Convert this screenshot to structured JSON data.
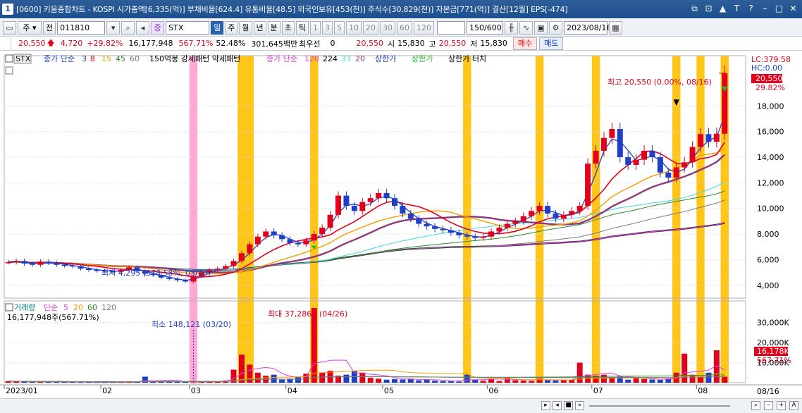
{
  "window": {
    "number": "1",
    "title": "[0600] 키움종합차트 - KOSPI 시가총액[6,335(억)] 부채비율[624.4] 유통비율[48.5] 외국인보유[453(천)] 주식수[30,829(천)] 자본금[771(억)] 결산[12월] EPS[-474]",
    "buttons": [
      "⧉",
      "⊡",
      "▲",
      "T",
      "?",
      "–",
      "□",
      "✕"
    ]
  },
  "toolbar": {
    "period_select": "주",
    "prev_label": "전",
    "code": "011810",
    "stock_name": "STX",
    "period_tabs": [
      "일",
      "주",
      "월",
      "년",
      "분",
      "초",
      "틱"
    ],
    "intervals": [
      "1",
      "3",
      "5",
      "10",
      "20",
      "30",
      "60",
      "120"
    ],
    "count": "150/600",
    "date": "2023/08/16"
  },
  "quote": {
    "price": "20,550",
    "change": "4,720",
    "change_pct": "+29.82%",
    "volume": "16,177,948",
    "vol_ratio": "567.71%",
    "turnover": "52.48%",
    "amount": "301,645백만",
    "pref_label": "최우선",
    "pref_val": "0",
    "ask": "20,550",
    "open_label": "시",
    "open": "15,830",
    "high_label": "고",
    "high": "20,550",
    "low_label": "저",
    "low": "15,830",
    "buy_label": "매수",
    "sell_label": "매도"
  },
  "price_legend": {
    "symbol": "STX",
    "ma_title": "종가 단순",
    "ma_periods": [
      "3",
      "8",
      "15",
      "45",
      "60"
    ],
    "tail": "150억봉 강세패턴  약세패턴",
    "ma2_title": "종가 단순",
    "ma2_periods": [
      "120",
      "224",
      "33",
      "20"
    ],
    "upper": "상한가",
    "upper2": "상한가",
    "upper_touch": "상한가 터치"
  },
  "volume_legend": {
    "title": "거래량",
    "ma_title": "단순",
    "ma_periods": [
      "5",
      "20",
      "60",
      "120"
    ],
    "current": "16,177,948주(567.71%)"
  },
  "annotations": {
    "high": "최고 20,550 (0.00%, 08/16)",
    "low": "최저 4,295 (378.58%, 03/10)",
    "vol_max": "최대 37,286K (04/26)",
    "vol_min": "최소 148,121 (03/20)",
    "lc": "LC:379.58",
    "hc": "HC:0.00",
    "price_tag": "20,550",
    "pct_tag": "29.82%",
    "vol_tag": "16,178K",
    "vol_pct_tag": "567.71%",
    "date_tag": "08/16"
  },
  "colors": {
    "up": "#e3001b",
    "down": "#1f3fc8",
    "highlight": "#ffc000",
    "pink": "#ff9ed0",
    "ma3": "#1f3fc8",
    "ma8": "#e3001b",
    "ma15": "#f0a000",
    "ma45": "#2a8a2a",
    "ma60": "#7a7a7a",
    "ma120": "#e040e0",
    "ma224": "#000000",
    "ma33": "#40d8e0",
    "ma20": "#8b3a7a"
  },
  "chart_data": [
    {
      "type": "candlestick",
      "title": "STX",
      "x_labels": [
        "2023/01",
        "02",
        "03",
        "04",
        "05",
        "06",
        "07",
        "08"
      ],
      "y_ticks": [
        4000,
        6000,
        8000,
        10000,
        12000,
        14000,
        16000,
        18000
      ],
      "ylim": [
        3000,
        20600
      ],
      "series": [
        {
          "name": "close",
          "values": [
            5800,
            5900,
            5700,
            5600,
            5850,
            5750,
            5600,
            5550,
            5500,
            5300,
            5200,
            5150,
            5100,
            5050,
            5200,
            5400,
            5100,
            4900,
            4800,
            4600,
            4500,
            4400,
            4295,
            4700,
            5000,
            5200,
            5300,
            5500,
            5900,
            6500,
            7200,
            7800,
            8200,
            7900,
            7600,
            7300,
            7200,
            7500,
            8000,
            8500,
            9500,
            11000,
            10200,
            9800,
            10500,
            10800,
            11200,
            10800,
            10200,
            9600,
            9200,
            8800,
            8600,
            8400,
            8300,
            8100,
            7900,
            7800,
            7700,
            7800,
            8200,
            8500,
            8800,
            9000,
            9400,
            9800,
            10200,
            9600,
            9200,
            9500,
            9800,
            10200,
            13500,
            14500,
            15500,
            16200,
            14000,
            13400,
            13800,
            14500,
            14000,
            12800,
            12400,
            13200,
            13600,
            14800,
            15800,
            15200,
            15830,
            20550
          ]
        }
      ],
      "highlight_bars": [
        23,
        29,
        30,
        38,
        57,
        66,
        73,
        83,
        86,
        89
      ]
    },
    {
      "type": "bar",
      "title": "거래량",
      "y_ticks_label": [
        "10,000K",
        "20,000K",
        "30,000K"
      ],
      "ylim": [
        0,
        38000
      ],
      "series": [
        {
          "name": "volume",
          "values": [
            800,
            600,
            700,
            500,
            400,
            600,
            500,
            400,
            350,
            300,
            500,
            400,
            300,
            350,
            400,
            500,
            600,
            3000,
            500,
            700,
            800,
            500,
            400,
            148,
            600,
            900,
            700,
            1100,
            6500,
            14000,
            9000,
            5000,
            3500,
            4000,
            1500,
            2000,
            3000,
            4500,
            37286,
            5000,
            6000,
            3500,
            4000,
            6000,
            5000,
            2500,
            2000,
            1500,
            1800,
            1600,
            2000,
            1200,
            1400,
            1000,
            800,
            700,
            600,
            4000,
            1500,
            1000,
            1800,
            900,
            2500,
            1200,
            1100,
            900,
            2000,
            1400,
            1100,
            1300,
            1500,
            10000,
            4000,
            3500,
            4000,
            2500,
            3000,
            1500,
            2200,
            1800,
            1600,
            1400,
            2000,
            5000,
            14500,
            4000,
            3000,
            5000,
            16178,
            3000
          ]
        }
      ]
    }
  ]
}
